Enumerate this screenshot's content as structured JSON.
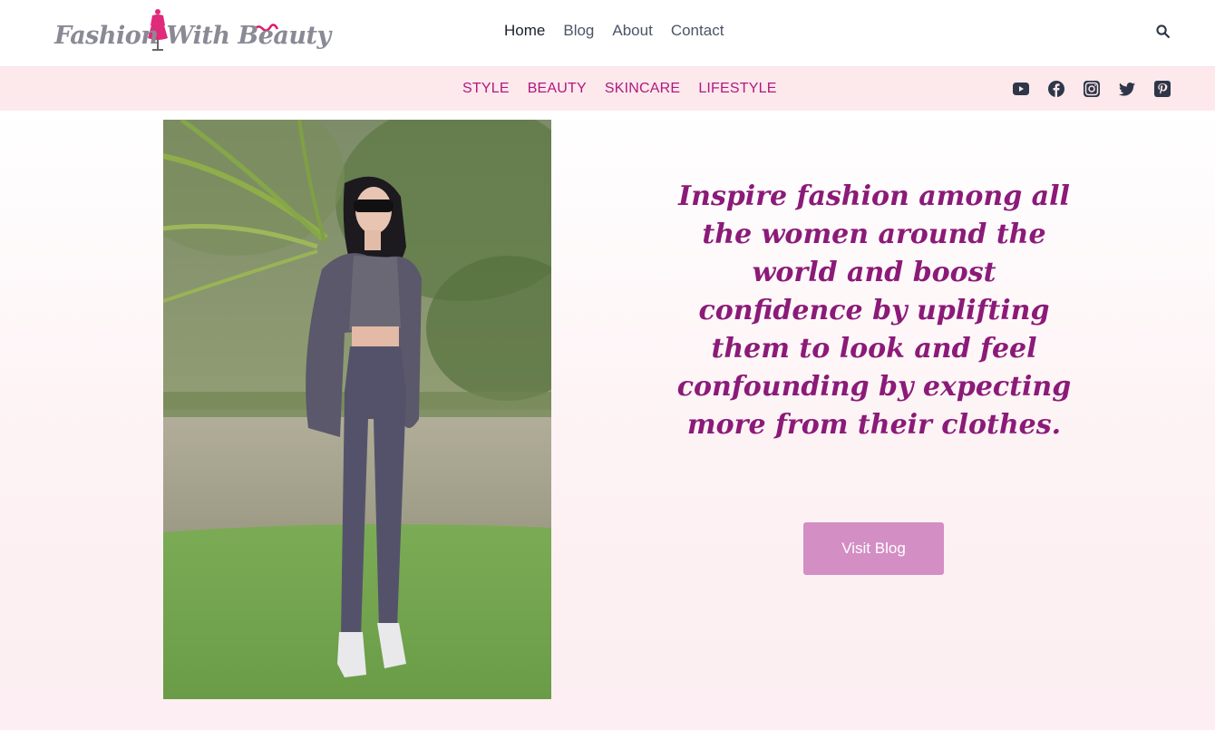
{
  "header": {
    "logo_text": "Fashion With Beauty",
    "nav": [
      {
        "label": "Home",
        "active": true
      },
      {
        "label": "Blog",
        "active": false
      },
      {
        "label": "About",
        "active": false
      },
      {
        "label": "Contact",
        "active": false
      }
    ],
    "search_icon": "search-icon"
  },
  "categories": [
    "STYLE",
    "BEAUTY",
    "SKINCARE",
    "LIFESTYLE"
  ],
  "social": [
    {
      "name": "youtube-icon"
    },
    {
      "name": "facebook-icon"
    },
    {
      "name": "instagram-icon"
    },
    {
      "name": "twitter-icon"
    },
    {
      "name": "pinterest-icon"
    }
  ],
  "hero": {
    "quote": "Inspire fashion among all the women around the world and boost confidence by uplifting them to look and feel confounding by expecting more from their clothes.",
    "button_label": "Visit Blog"
  },
  "colors": {
    "accent": "#b0197f",
    "quote": "#8b1a78",
    "button": "#d38ec4",
    "category_bar": "#fde8ec"
  }
}
